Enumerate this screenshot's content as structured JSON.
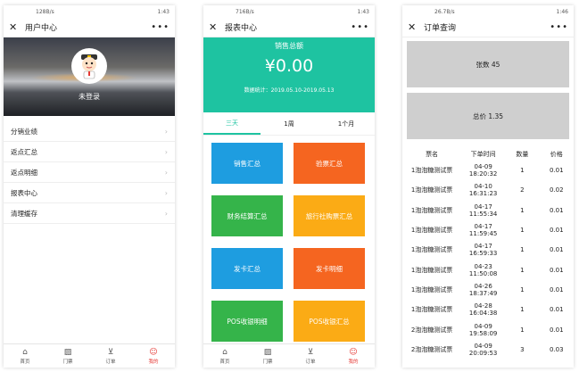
{
  "screens": [
    {
      "status": {
        "left": "128B/s",
        "right": "1:43"
      },
      "title": "用户中心",
      "login_label": "未登录",
      "menu": [
        {
          "label": "分销业绩"
        },
        {
          "label": "返点汇总"
        },
        {
          "label": "返点明细"
        },
        {
          "label": "报表中心"
        },
        {
          "label": "清理缓存"
        }
      ]
    },
    {
      "status": {
        "left": "716B/s",
        "right": "1:43"
      },
      "title": "报表中心",
      "sales_label": "销售总额",
      "sales_amount": "¥0.00",
      "date_range": "数据统计：2019.05.10-2019.05.13",
      "tabs": [
        {
          "label": "三天",
          "active": true
        },
        {
          "label": "1周",
          "active": false
        },
        {
          "label": "1个月",
          "active": false
        }
      ],
      "buttons": [
        {
          "label": "销售汇总",
          "color": "#1e9de0"
        },
        {
          "label": "验票汇总",
          "color": "#f56520"
        },
        {
          "label": "财务结算汇总",
          "color": "#35b44a"
        },
        {
          "label": "旅行社购票汇总",
          "color": "#fbab15"
        },
        {
          "label": "发卡汇总",
          "color": "#1e9de0"
        },
        {
          "label": "发卡明细",
          "color": "#f56520"
        },
        {
          "label": "POS收银明细",
          "color": "#35b44a"
        },
        {
          "label": "POS收银汇总",
          "color": "#fbab15"
        }
      ]
    },
    {
      "status": {
        "left": "26.7B/s",
        "right": "1:46"
      },
      "title": "订单查询",
      "count_label": "张数 45",
      "total_label": "总价 1.35",
      "headers": [
        "票名",
        "下单时间",
        "数量",
        "价格"
      ],
      "rows": [
        [
          "1泡泡糖测试票",
          "04-09 18:20:32",
          "1",
          "0.01"
        ],
        [
          "1泡泡糖测试票",
          "04-10 16:31:23",
          "2",
          "0.02"
        ],
        [
          "1泡泡糖测试票",
          "04-17 11:55:34",
          "1",
          "0.01"
        ],
        [
          "1泡泡糖测试票",
          "04-17 11:59:45",
          "1",
          "0.01"
        ],
        [
          "1泡泡糖测试票",
          "04-17 16:59:33",
          "1",
          "0.01"
        ],
        [
          "1泡泡糖测试票",
          "04-23 11:50:08",
          "1",
          "0.01"
        ],
        [
          "1泡泡糖测试票",
          "04-26 18:37:49",
          "1",
          "0.01"
        ],
        [
          "1泡泡糖测试票",
          "04-28 16:04:38",
          "1",
          "0.01"
        ],
        [
          "2泡泡糖测试票",
          "04-09 19:58:09",
          "1",
          "0.01"
        ],
        [
          "2泡泡糖测试票",
          "04-09 20:09:53",
          "3",
          "0.03"
        ]
      ]
    }
  ],
  "tabbar": [
    {
      "label": "首页",
      "icon": "home-icon"
    },
    {
      "label": "门票",
      "icon": "ticket-icon"
    },
    {
      "label": "订单",
      "icon": "cart-icon"
    },
    {
      "label": "我的",
      "icon": "user-icon"
    }
  ],
  "colors": {
    "accent_green": "#1ec3a1",
    "tab_active": "#e53935"
  }
}
